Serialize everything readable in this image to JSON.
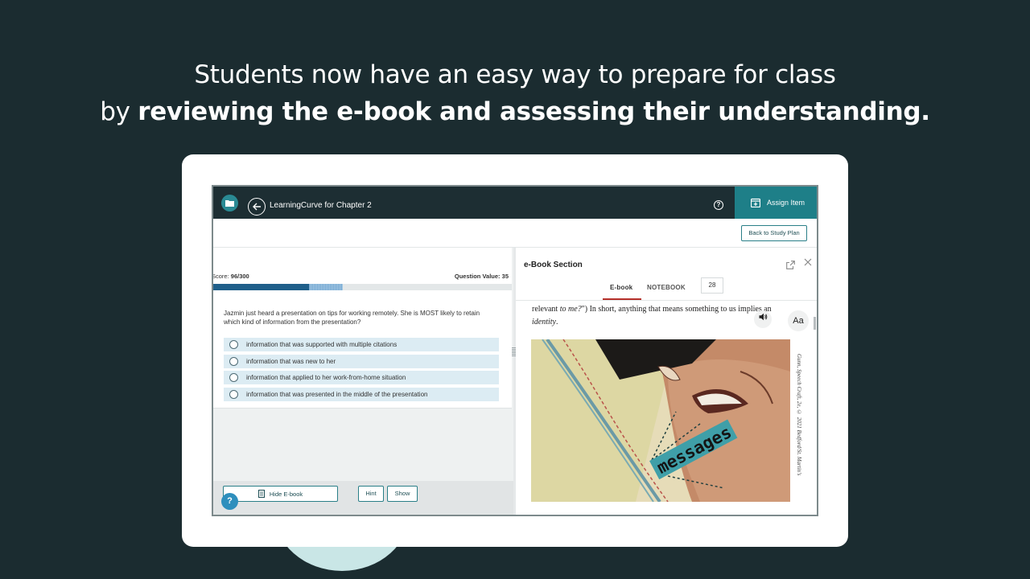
{
  "headline": {
    "line1": "Students now have an easy way to prepare for class",
    "line2_prefix": "by ",
    "line2_bold": "reviewing the e-book and assessing their understanding."
  },
  "app": {
    "title": "LearningCurve for Chapter 2",
    "help_icon_glyph": "?",
    "assign_label": "Assign Item",
    "back_to_study_plan": "Back to Study Plan"
  },
  "quiz": {
    "score_label": "Score:",
    "score_value": "96/300",
    "question_value_label": "Question Value:",
    "question_value": "35",
    "progress": {
      "completed_fraction": 0.32,
      "pending_fraction": 0.115
    },
    "question": "Jazmin just heard a presentation on tips for working remotely. She is MOST likely to retain which kind of information from the presentation?",
    "options": [
      "information that was supported with multiple citations",
      "information that was new to her",
      "information that applied to her work-from-home situation",
      "information that was presented in the middle of the presentation"
    ],
    "hide_ebook_label": "Hide E-book",
    "hint_label": "Hint",
    "show_label": "Show",
    "help_fab_glyph": "?"
  },
  "ebook": {
    "section_title": "e-Book Section",
    "tab_ebook": "E-book",
    "tab_notebook": "NOTEBOOK",
    "page_number": "28",
    "text_before_italic1": "relevant ",
    "italic1": "to me?",
    "text_after_italic1": "\") In short, anything that means something to us implies an",
    "italic2": "identity",
    "text_after_italic2": ".",
    "audio_icon_glyph": "🔊",
    "font_size_label": "Aa",
    "illustration_label": "messages",
    "illustration_credit": "Gunn, Speech Craft, 2e, © 2021 Bedford/St. Martin's"
  },
  "icons": {
    "folder": "folder-icon",
    "back": "back-arrow-icon",
    "calendar": "calendar-add-icon",
    "popout": "external-link-icon",
    "close": "close-icon",
    "document": "document-icon"
  },
  "colors": {
    "background": "#1b2c30",
    "topbar": "#1d2e33",
    "accent_teal": "#1e7f88",
    "progress": "#1f5f8a",
    "option_bg": "#dcecf3",
    "tab_underline": "#b5302a"
  }
}
